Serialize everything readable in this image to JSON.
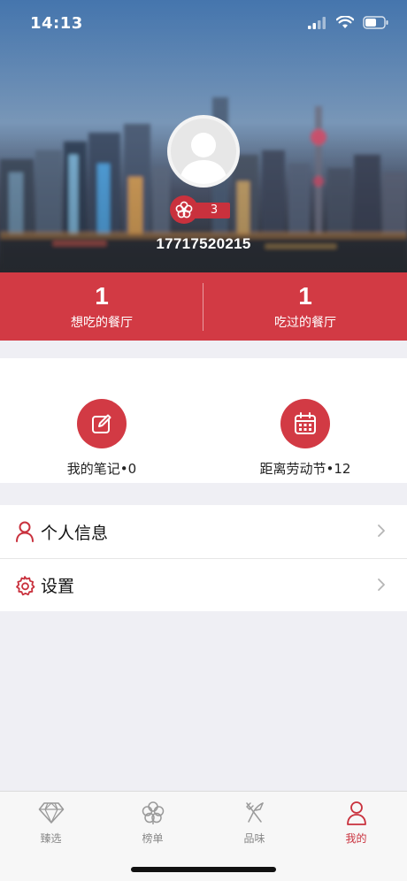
{
  "status_bar": {
    "time": "14:13"
  },
  "profile": {
    "badge_count": "3",
    "phone": "17717520215"
  },
  "stats": [
    {
      "value": "1",
      "label": "想吃的餐厅"
    },
    {
      "value": "1",
      "label": "吃过的餐厅"
    }
  ],
  "actions": [
    {
      "label": "我的笔记•0",
      "icon": "edit-icon"
    },
    {
      "label": "距离劳动节•12",
      "icon": "calendar-icon"
    }
  ],
  "menu": [
    {
      "label": "个人信息",
      "icon": "person-icon"
    },
    {
      "label": "设置",
      "icon": "gear-icon"
    }
  ],
  "tabs": [
    {
      "label": "臻选",
      "icon": "diamond-icon",
      "active": false
    },
    {
      "label": "榜单",
      "icon": "flower-icon",
      "active": false
    },
    {
      "label": "品味",
      "icon": "fork-knife-icon",
      "active": false
    },
    {
      "label": "我的",
      "icon": "person-icon",
      "active": true
    }
  ],
  "colors": {
    "accent": "#d23a44",
    "tab_active": "#c9313d",
    "tab_inactive": "#888888"
  }
}
